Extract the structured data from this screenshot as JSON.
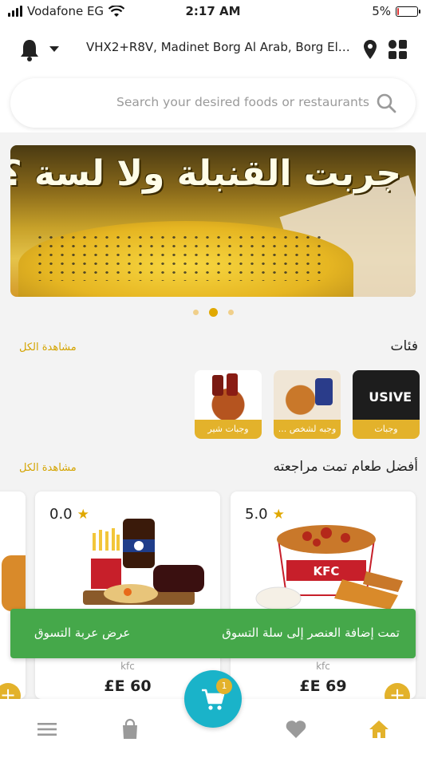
{
  "status_bar": {
    "carrier": "Vodafone EG",
    "time": "2:17 AM",
    "battery_text": "5%",
    "battery_level": 0.05
  },
  "header": {
    "address": "VHX2+R8V, Madinet Borg Al Arab, Borg El ...",
    "icons": [
      "bell-icon",
      "chevron-down-icon",
      "location-pin-icon",
      "grid-menu-icon"
    ]
  },
  "search": {
    "placeholder": "Search your desired foods or restaurants"
  },
  "banner": {
    "headline": "جربت القنبلة ولا لسة ؟",
    "slide_count": 3,
    "active_slide": 2
  },
  "categories": {
    "title": "فئات",
    "see_all": "مشاهدة الكل",
    "items": [
      {
        "label": "وجبات",
        "image_text": "USIVE"
      },
      {
        "label": "وجبه لشخص ..."
      },
      {
        "label": "وجبات شير"
      }
    ]
  },
  "top_reviewed": {
    "title": "أفضل طعام تمت مراجعته",
    "see_all": "مشاهدة الكل",
    "items": [
      {
        "rating": "5.0",
        "brand": "kfc",
        "price": "£E 69"
      },
      {
        "rating": "0.0",
        "brand": "kfc",
        "price": "£E 60"
      }
    ]
  },
  "snackbar": {
    "message": "تمت إضافة العنصر إلى سلة التسوق",
    "action": "عرض عربة التسوق"
  },
  "bottom_nav": {
    "cart_badge": "1",
    "active": "home",
    "items": [
      "menu-icon",
      "bag-icon",
      "cart-icon",
      "heart-icon",
      "home-icon"
    ]
  },
  "colors": {
    "accent": "#e3b22b",
    "see_all": "#d4a400",
    "snackbar": "#45a84a",
    "cart_fab": "#1ab3c9"
  }
}
